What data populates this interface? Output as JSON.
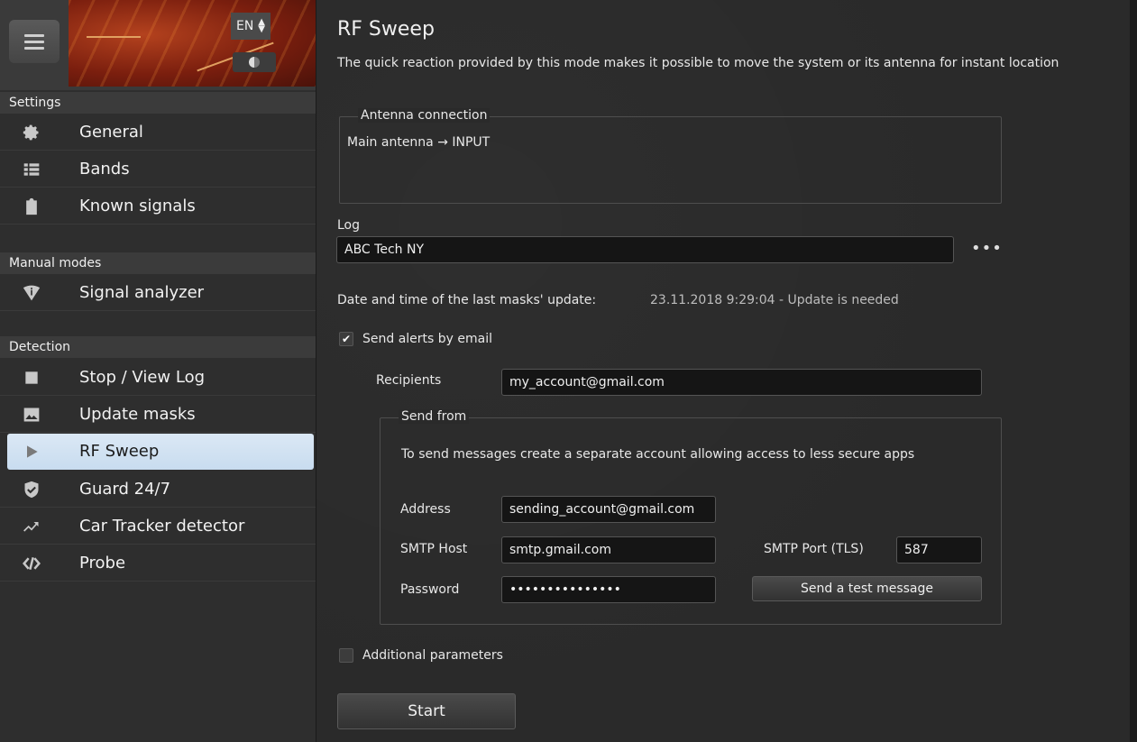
{
  "header": {
    "language": "EN"
  },
  "sidebar": {
    "sections": [
      {
        "title": "Settings"
      },
      {
        "title": "Manual modes"
      },
      {
        "title": "Detection"
      }
    ],
    "items": [
      {
        "label": "General",
        "icon": "gear-icon"
      },
      {
        "label": "Bands",
        "icon": "list-icon"
      },
      {
        "label": "Known signals",
        "icon": "clipboard-icon"
      },
      {
        "label": "Signal analyzer",
        "icon": "signal-icon"
      },
      {
        "label": "Stop / View Log",
        "icon": "stop-icon"
      },
      {
        "label": "Update masks",
        "icon": "image-icon"
      },
      {
        "label": "RF Sweep",
        "icon": "play-icon",
        "active": true
      },
      {
        "label": "Guard 24/7",
        "icon": "shield-check-icon"
      },
      {
        "label": "Car Tracker detector",
        "icon": "trend-icon"
      },
      {
        "label": "Probe",
        "icon": "code-icon"
      }
    ]
  },
  "main": {
    "title": "RF Sweep",
    "description": "The quick reaction provided by this mode makes it possible to move the system or its antenna for instant location",
    "antenna": {
      "legend": "Antenna connection",
      "text": "Main antenna → INPUT"
    },
    "log": {
      "label": "Log",
      "value": "ABC Tech NY",
      "more": "•••"
    },
    "masks_update": {
      "label": "Date and time of the last masks' update:",
      "value": "23.11.2018 9:29:04 - Update is needed"
    },
    "email_alerts": {
      "label": "Send alerts by email",
      "checked": true,
      "recipients_label": "Recipients",
      "recipients_value": "my_account@gmail.com"
    },
    "send_from": {
      "legend": "Send from",
      "hint": "To send messages create a separate account allowing access to less secure apps",
      "address_label": "Address",
      "address_value": "sending_account@gmail.com",
      "smtp_host_label": "SMTP Host",
      "smtp_host_value": "smtp.gmail.com",
      "smtp_port_label": "SMTP Port (TLS)",
      "smtp_port_value": "587",
      "password_label": "Password",
      "password_value": "•••••••••••••••",
      "test_button": "Send a test message"
    },
    "additional": {
      "label": "Additional parameters",
      "checked": false
    },
    "start_button": "Start"
  },
  "colors": {
    "background": "#2a2a2a",
    "sidebar": "#2e2e2e",
    "active_item": "#d3e3f3",
    "field": "#151515"
  }
}
